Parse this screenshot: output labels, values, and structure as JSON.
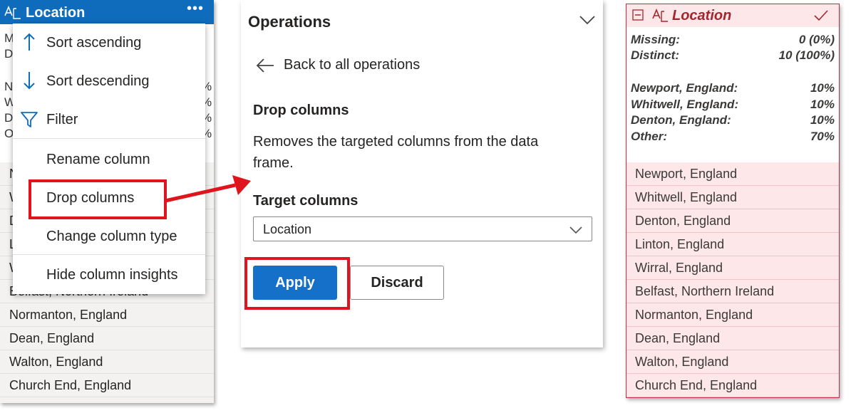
{
  "colors": {
    "header_blue": "#0f6cbd",
    "primary_button": "#1470c8",
    "highlight_red": "#e0141c",
    "dropped_column_bg": "#fde7e9",
    "dropped_column_text": "#a4262c"
  },
  "left_column": {
    "header": {
      "title": "Location",
      "type_icon": "text-type-icon",
      "more_icon": "more-icon",
      "more_label": "•••"
    },
    "stats_fragments": [
      {
        "left": "M",
        "right": ")"
      },
      {
        "left": "D",
        "right": ")"
      },
      {
        "left": "",
        "right": ""
      },
      {
        "left": "N",
        "right": "%"
      },
      {
        "left": "W",
        "right": "%"
      },
      {
        "left": "D",
        "right": "%"
      },
      {
        "left": "O",
        "right": "%"
      }
    ],
    "row_fragments": [
      "N",
      "W",
      "D",
      "L",
      "W"
    ],
    "rows": [
      "Belfast, Northern Ireland",
      "Normanton, England",
      "Dean, England",
      "Walton, England",
      "Church End, England"
    ]
  },
  "context_menu": {
    "items": [
      {
        "label": "Sort ascending",
        "icon": "arrow-up-icon"
      },
      {
        "label": "Sort descending",
        "icon": "arrow-down-icon"
      },
      {
        "label": "Filter",
        "icon": "filter-icon"
      },
      {
        "label": "Rename column",
        "icon": ""
      },
      {
        "label": "Drop columns",
        "icon": ""
      },
      {
        "label": "Change column type",
        "icon": ""
      },
      {
        "label": "Hide column insights",
        "icon": ""
      }
    ]
  },
  "operations": {
    "title": "Operations",
    "collapse_icon": "chevron-down-icon",
    "back_label": "Back to all operations",
    "back_icon": "arrow-left-icon",
    "op_heading": "Drop columns",
    "op_description": "Removes the targeted columns from the data frame.",
    "target_label": "Target columns",
    "target_value": "Location",
    "apply_label": "Apply",
    "discard_label": "Discard"
  },
  "right_column": {
    "header": {
      "title": "Location",
      "collapse_icon": "minus-square-icon",
      "type_icon": "text-type-icon",
      "check_icon": "checkmark-icon"
    },
    "stats": [
      {
        "key": "Missing:",
        "value": "0 (0%)"
      },
      {
        "key": "Distinct:",
        "value": "10 (100%)"
      }
    ],
    "top_values": [
      {
        "key": "Newport, England:",
        "value": "10%"
      },
      {
        "key": "Whitwell, England:",
        "value": "10%"
      },
      {
        "key": "Denton, England:",
        "value": "10%"
      },
      {
        "key": "Other:",
        "value": "70%"
      }
    ],
    "rows": [
      "Newport, England",
      "Whitwell, England",
      "Denton, England",
      "Linton, England",
      "Wirral, England",
      "Belfast, Northern Ireland",
      "Normanton, England",
      "Dean, England",
      "Walton, England",
      "Church End, England"
    ]
  }
}
